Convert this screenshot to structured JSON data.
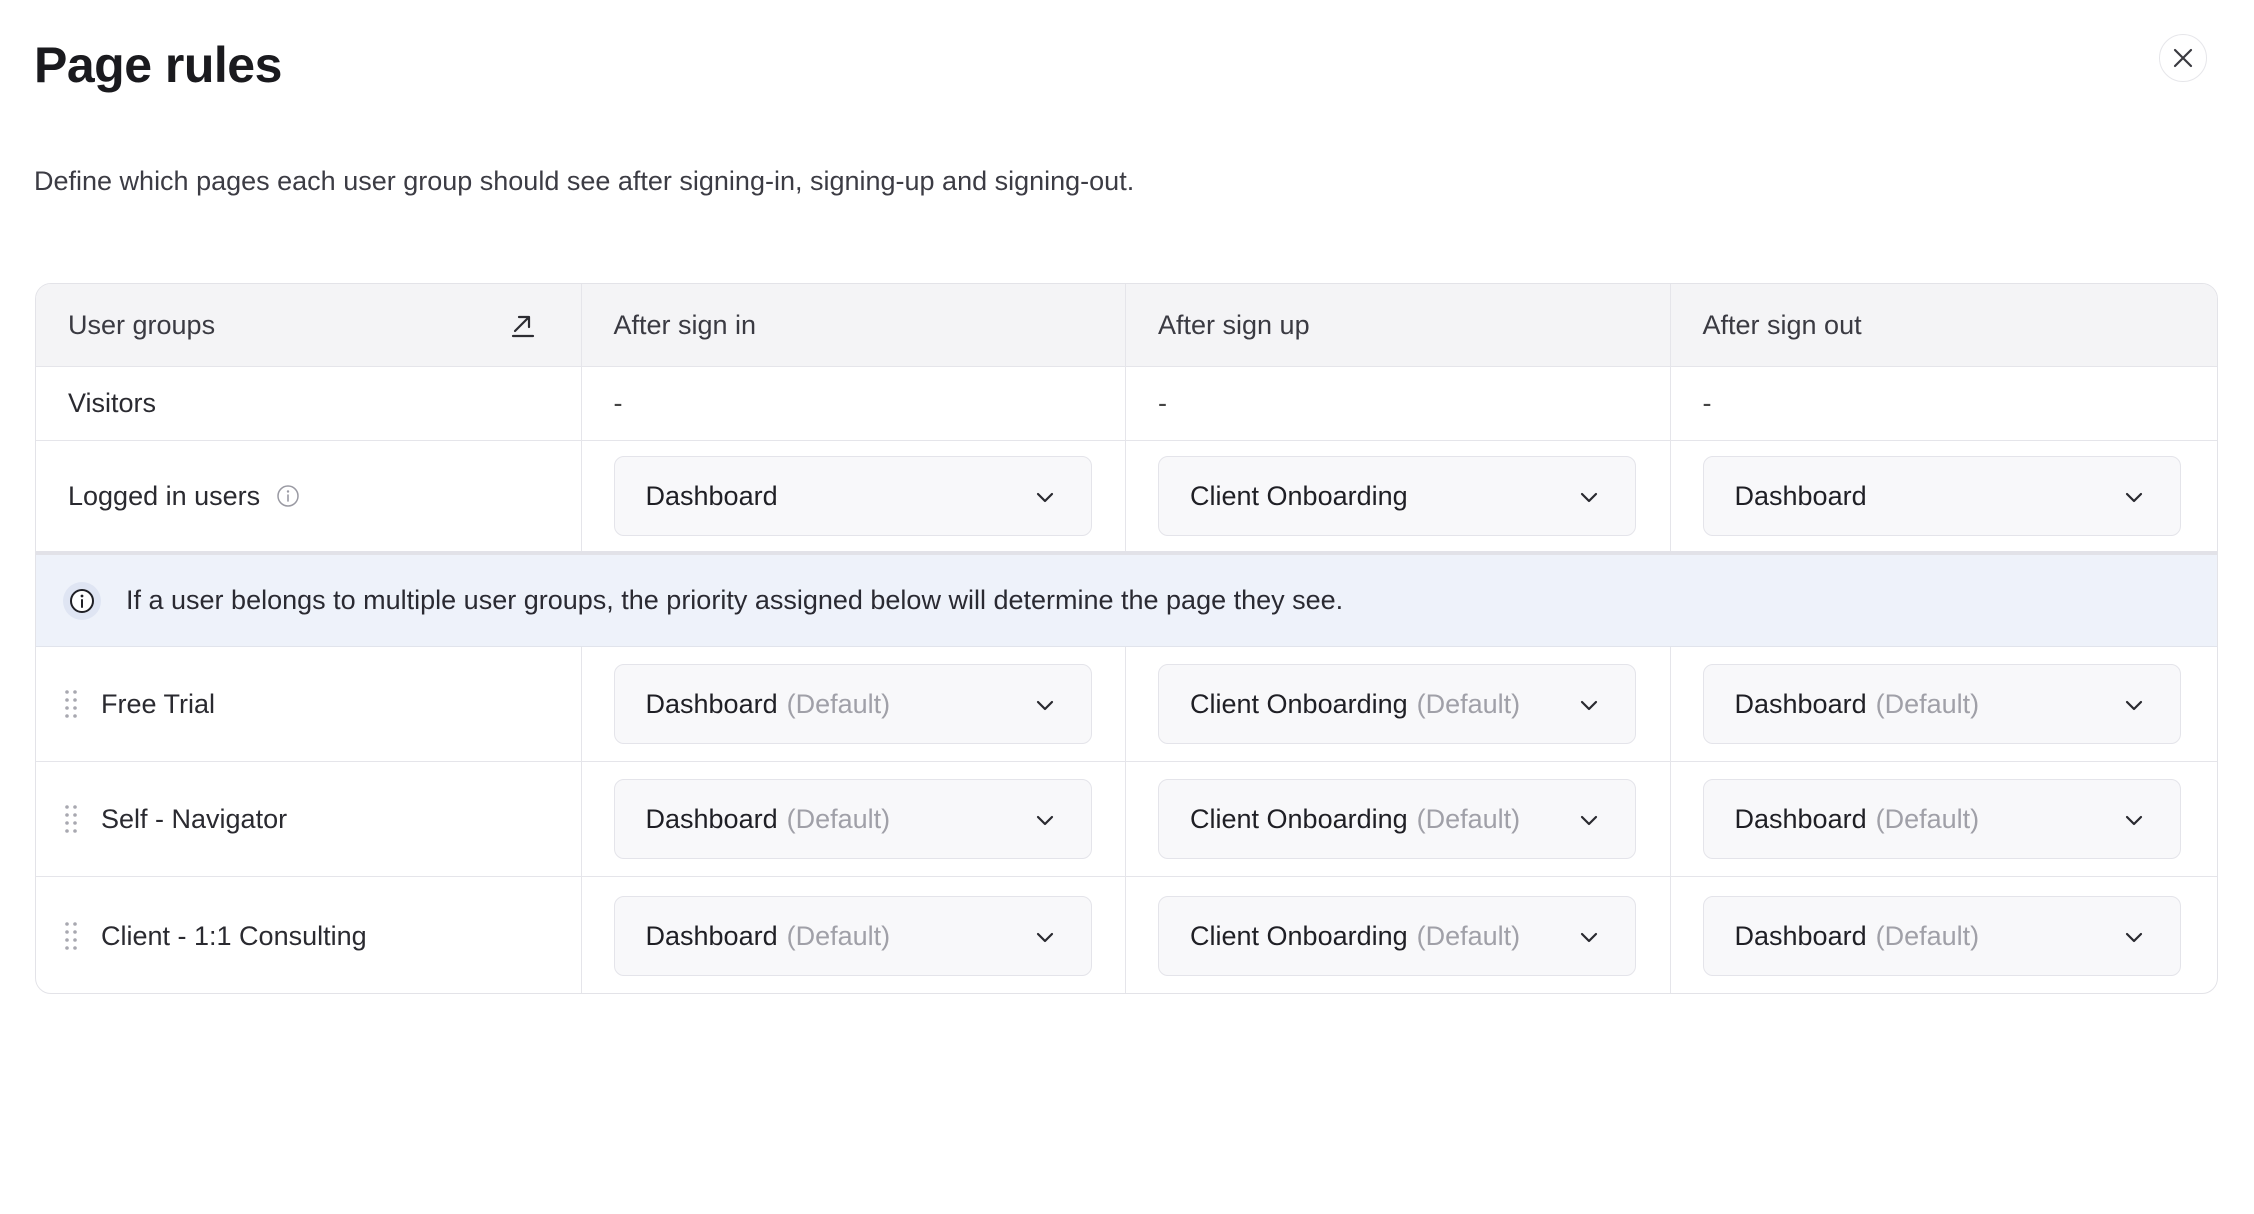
{
  "page": {
    "title": "Page rules",
    "subtitle": "Define which pages each user group should see after signing-in, signing-up and signing-out."
  },
  "table": {
    "headers": [
      "User groups",
      "After sign in",
      "After sign up",
      "After sign out"
    ],
    "visitors": {
      "label": "Visitors",
      "values": [
        "-",
        "-",
        "-"
      ]
    },
    "logged_in": {
      "label": "Logged in users",
      "values": [
        "Dashboard",
        "Client Onboarding",
        "Dashboard"
      ]
    },
    "banner": "If a user belongs to multiple user groups, the priority assigned below will determine the page they see.",
    "default_tag": "(Default)",
    "groups": [
      {
        "label": "Free Trial",
        "values": [
          "Dashboard",
          "Client Onboarding",
          "Dashboard"
        ]
      },
      {
        "label": "Self - Navigator",
        "values": [
          "Dashboard",
          "Client Onboarding",
          "Dashboard"
        ]
      },
      {
        "label": "Client - 1:1 Consulting",
        "values": [
          "Dashboard",
          "Client Onboarding",
          "Dashboard"
        ]
      }
    ]
  }
}
